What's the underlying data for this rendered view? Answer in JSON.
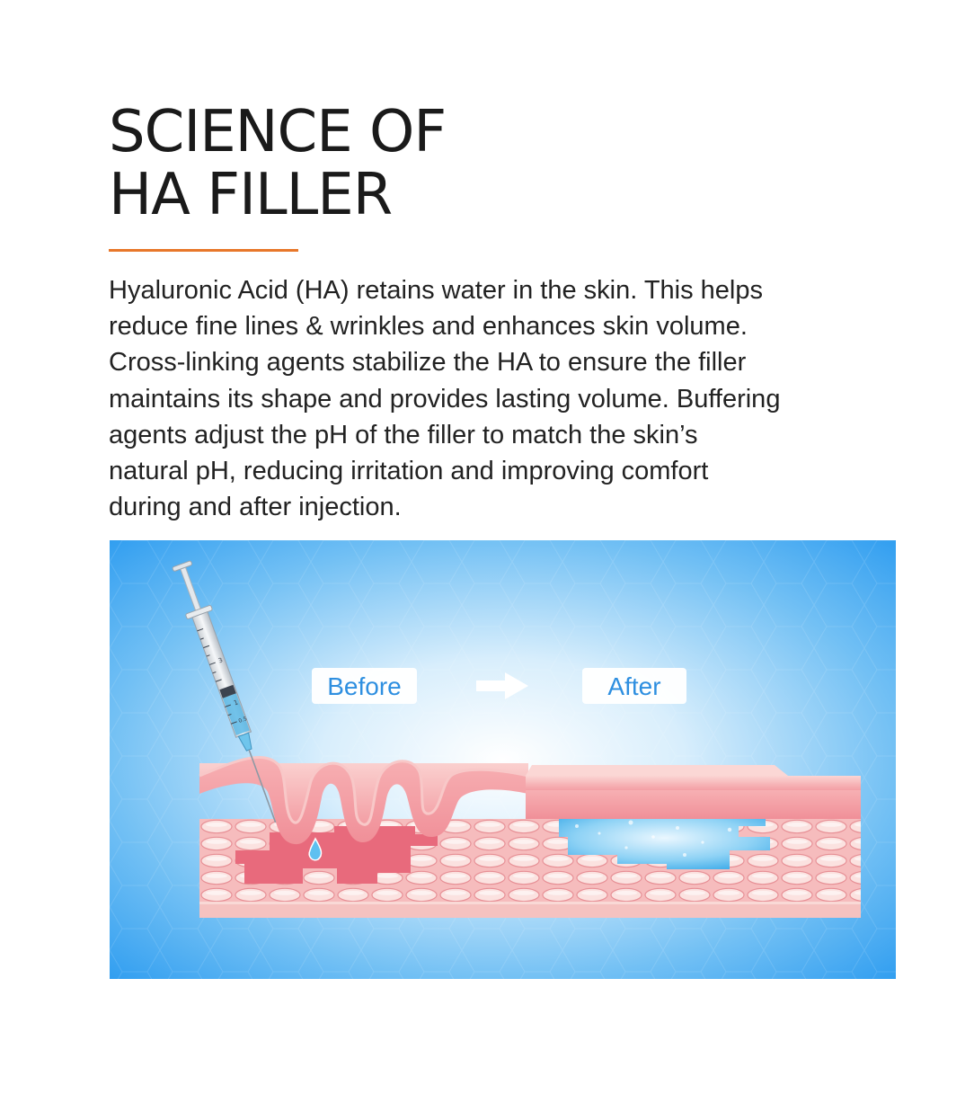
{
  "heading": {
    "line1": "SCIENCE OF",
    "line2": "HA FILLER"
  },
  "accent_color": "#e8772a",
  "description_lines": [
    "Hyaluronic Acid (HA) retains water in the skin. This helps",
    "reduce fine lines & wrinkles and enhances skin volume.",
    "Cross-linking agents stabilize the HA to ensure the filler",
    "maintains its shape and provides lasting volume. Buffering",
    "agents adjust the pH of the filler to match the skin’s",
    "natural pH, reducing irritation and improving comfort",
    "during and after injection."
  ],
  "illustration": {
    "before_label": "Before",
    "after_label": "After",
    "syringe_markings": [
      "3",
      "1",
      "0.5"
    ],
    "background_color": "#2f9ff0",
    "skin_color": "#f4a0a6",
    "filler_color": "#4fb4ea"
  }
}
